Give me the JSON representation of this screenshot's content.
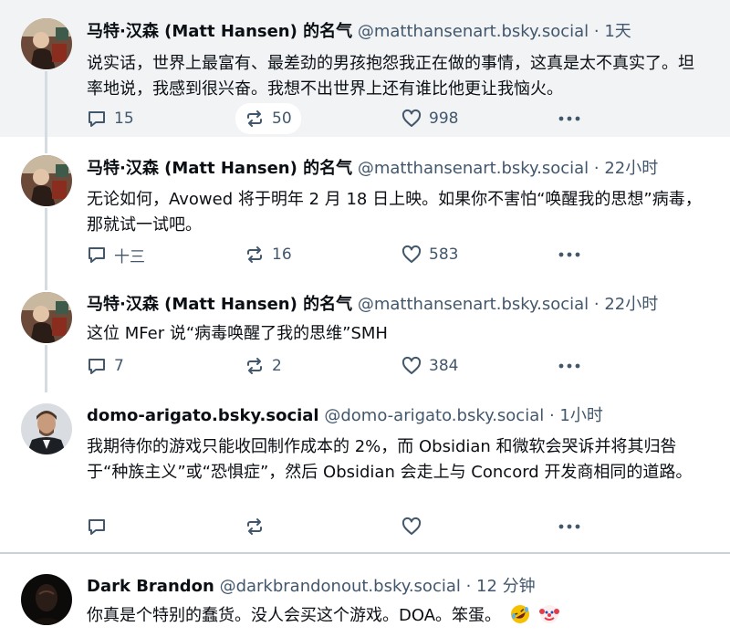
{
  "posts": [
    {
      "author": "马特·汉森 (Matt Hansen) 的名气",
      "handle": "@matthansenart.bsky.social",
      "time": "· 1天",
      "text": "说实话，世界上最富有、最差劲的男孩抱怨我正在做的事情，这真是太不真实了。坦率地说，我感到很兴奋。我想不出世界上还有谁比他更让我恼火。",
      "replies": "15",
      "reposts": "50",
      "likes": "998"
    },
    {
      "author": "马特·汉森 (Matt Hansen) 的名气",
      "handle": "@matthansenart.bsky.social",
      "time": "· 22小时",
      "text": "无论如何，Avowed 将于明年 2 月 18 日上映。如果你不害怕“唤醒我的思想”病毒，那就试一试吧。",
      "replies": "十三",
      "reposts": "16",
      "likes": "583"
    },
    {
      "author": "马特·汉森 (Matt Hansen) 的名气",
      "handle": "@matthansenart.bsky.social",
      "time": "· 22小时",
      "text": "这位 MFer 说“病毒唤醒了我的思维”SMH",
      "replies": "7",
      "reposts": "2",
      "likes": "384"
    },
    {
      "author": "domo-arigato.bsky.social",
      "handle": "@domo-arigato.bsky.social",
      "time": "· 1小时",
      "text": "我期待你的游戏只能收回制作成本的 2%，而 Obsidian 和微软会哭诉并将其归咎于“种族主义”或“恐惧症”，然后 Obsidian 会走上与 Concord 开发商相同的道路。",
      "replies": "",
      "reposts": "",
      "likes": ""
    },
    {
      "author": "Dark Brandon",
      "handle": "@darkbrandonout.bsky.social",
      "time": "· 12 分钟",
      "text": "你真是个特别的蠢货。没人会买这个游戏。DOA。笨蛋。",
      "emojis": [
        "rolling-on-floor-laughing-emoji",
        "clown-face-emoji"
      ]
    }
  ],
  "colors": {
    "highlight_bg": "#f1f3f5",
    "meta_text": "#42576c",
    "thread_line": "#d4dbe2"
  }
}
